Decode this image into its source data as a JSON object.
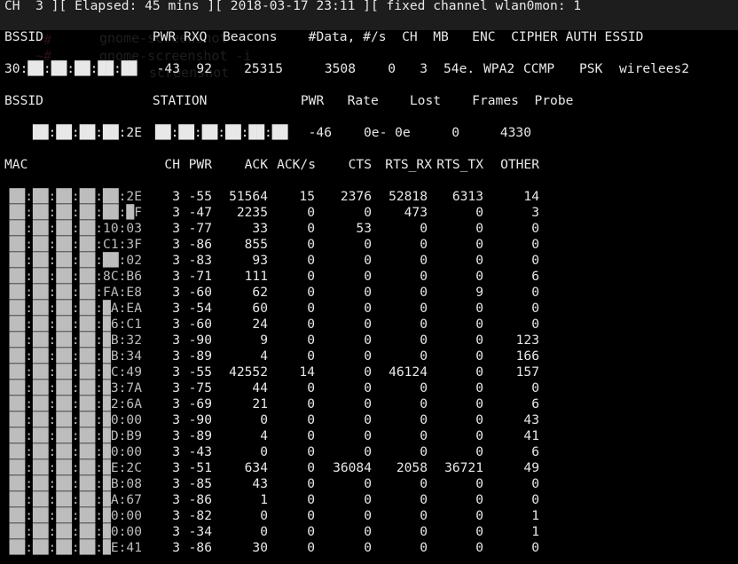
{
  "status_line": "CH  3 ][ Elapsed: 45 mins ][ 2018-03-17 23:11 ][ fixed channel wlan0mon: 1",
  "ghost_overlay": [
    "gnome-screenshot",
    "gnome-screenshot -i",
    "screenshot"
  ],
  "ap_table": {
    "header": "BSSID              PWR RXQ  Beacons    #Data, #/s  CH  MB   ENC  CIPHER AUTH ESSID",
    "rows": [
      {
        "bssid": "30:██:██:██:██:██",
        "pwr": "-43",
        "rxq": "92",
        "beacons": "25315",
        "data": "3508",
        "per_s": "0",
        "ch": "3",
        "mb": "54e.",
        "enc": "WPA2",
        "cipher": "CCMP",
        "auth": "PSK",
        "essid": "wirelees2"
      }
    ]
  },
  "station_table": {
    "header": "BSSID              STATION            PWR   Rate    Lost    Frames  Probe",
    "rows": [
      {
        "bssid": "██:██:██:██:2E",
        "station": "██:██:██:██:██:██",
        "pwr": "-46",
        "rate": "0e- 0e",
        "lost": "0",
        "frames": "4330",
        "probe": ""
      }
    ]
  },
  "mac_table": {
    "headers": [
      "MAC",
      "CH",
      "PWR",
      "ACK",
      "ACK/s",
      "CTS",
      "RTS_RX",
      "RTS_TX",
      "OTHER"
    ],
    "rows": [
      {
        "mac": "██:██:██:██:██:2E",
        "ch": "3",
        "pwr": "-55",
        "ack": "51564",
        "ack_s": "15",
        "cts": "2376",
        "rts_rx": "52818",
        "rts_tx": "6313",
        "other": "14"
      },
      {
        "mac": "██:██:██:██:██:█F",
        "ch": "3",
        "pwr": "-47",
        "ack": "2235",
        "ack_s": "0",
        "cts": "0",
        "rts_rx": "473",
        "rts_tx": "0",
        "other": "3"
      },
      {
        "mac": "██:██:██:██:10:03",
        "ch": "3",
        "pwr": "-77",
        "ack": "33",
        "ack_s": "0",
        "cts": "53",
        "rts_rx": "0",
        "rts_tx": "0",
        "other": "0"
      },
      {
        "mac": "██:██:██:██:C1:3F",
        "ch": "3",
        "pwr": "-86",
        "ack": "855",
        "ack_s": "0",
        "cts": "0",
        "rts_rx": "0",
        "rts_tx": "0",
        "other": "0"
      },
      {
        "mac": "██:██:██:██:██:02",
        "ch": "3",
        "pwr": "-83",
        "ack": "93",
        "ack_s": "0",
        "cts": "0",
        "rts_rx": "0",
        "rts_tx": "0",
        "other": "0"
      },
      {
        "mac": "██:██:██:██:8C:B6",
        "ch": "3",
        "pwr": "-71",
        "ack": "111",
        "ack_s": "0",
        "cts": "0",
        "rts_rx": "0",
        "rts_tx": "0",
        "other": "6"
      },
      {
        "mac": "██:██:██:██:FA:E8",
        "ch": "3",
        "pwr": "-60",
        "ack": "62",
        "ack_s": "0",
        "cts": "0",
        "rts_rx": "0",
        "rts_tx": "9",
        "other": "0"
      },
      {
        "mac": "██:██:██:██:█A:EA",
        "ch": "3",
        "pwr": "-54",
        "ack": "60",
        "ack_s": "0",
        "cts": "0",
        "rts_rx": "0",
        "rts_tx": "0",
        "other": "0"
      },
      {
        "mac": "██:██:██:██:█6:C1",
        "ch": "3",
        "pwr": "-60",
        "ack": "24",
        "ack_s": "0",
        "cts": "0",
        "rts_rx": "0",
        "rts_tx": "0",
        "other": "0"
      },
      {
        "mac": "██:██:██:██:█B:32",
        "ch": "3",
        "pwr": "-90",
        "ack": "9",
        "ack_s": "0",
        "cts": "0",
        "rts_rx": "0",
        "rts_tx": "0",
        "other": "123"
      },
      {
        "mac": "██:██:██:██:█B:34",
        "ch": "3",
        "pwr": "-89",
        "ack": "4",
        "ack_s": "0",
        "cts": "0",
        "rts_rx": "0",
        "rts_tx": "0",
        "other": "166"
      },
      {
        "mac": "██:██:██:██:█C:49",
        "ch": "3",
        "pwr": "-55",
        "ack": "42552",
        "ack_s": "14",
        "cts": "0",
        "rts_rx": "46124",
        "rts_tx": "0",
        "other": "157"
      },
      {
        "mac": "██:██:██:██:█3:7A",
        "ch": "3",
        "pwr": "-75",
        "ack": "44",
        "ack_s": "0",
        "cts": "0",
        "rts_rx": "0",
        "rts_tx": "0",
        "other": "0"
      },
      {
        "mac": "██:██:██:██:█2:6A",
        "ch": "3",
        "pwr": "-69",
        "ack": "21",
        "ack_s": "0",
        "cts": "0",
        "rts_rx": "0",
        "rts_tx": "0",
        "other": "6"
      },
      {
        "mac": "██:██:██:██:█0:00",
        "ch": "3",
        "pwr": "-90",
        "ack": "0",
        "ack_s": "0",
        "cts": "0",
        "rts_rx": "0",
        "rts_tx": "0",
        "other": "43"
      },
      {
        "mac": "██:██:██:██:█D:B9",
        "ch": "3",
        "pwr": "-89",
        "ack": "4",
        "ack_s": "0",
        "cts": "0",
        "rts_rx": "0",
        "rts_tx": "0",
        "other": "41"
      },
      {
        "mac": "██:██:██:██:█0:00",
        "ch": "3",
        "pwr": "-43",
        "ack": "0",
        "ack_s": "0",
        "cts": "0",
        "rts_rx": "0",
        "rts_tx": "0",
        "other": "6"
      },
      {
        "mac": "██:██:██:██:█E:2C",
        "ch": "3",
        "pwr": "-51",
        "ack": "634",
        "ack_s": "0",
        "cts": "36084",
        "rts_rx": "2058",
        "rts_tx": "36721",
        "other": "49"
      },
      {
        "mac": "██:██:██:██:█B:08",
        "ch": "3",
        "pwr": "-85",
        "ack": "43",
        "ack_s": "0",
        "cts": "0",
        "rts_rx": "0",
        "rts_tx": "0",
        "other": "0"
      },
      {
        "mac": "██:██:██:██:█A:67",
        "ch": "3",
        "pwr": "-86",
        "ack": "1",
        "ack_s": "0",
        "cts": "0",
        "rts_rx": "0",
        "rts_tx": "0",
        "other": "0"
      },
      {
        "mac": "██:██:██:██:█0:00",
        "ch": "3",
        "pwr": "-82",
        "ack": "0",
        "ack_s": "0",
        "cts": "0",
        "rts_rx": "0",
        "rts_tx": "0",
        "other": "1"
      },
      {
        "mac": "██:██:██:██:█0:00",
        "ch": "3",
        "pwr": "-34",
        "ack": "0",
        "ack_s": "0",
        "cts": "0",
        "rts_rx": "0",
        "rts_tx": "0",
        "other": "1"
      },
      {
        "mac": "██:██:██:██:█E:41",
        "ch": "3",
        "pwr": "-86",
        "ack": "30",
        "ack_s": "0",
        "cts": "0",
        "rts_rx": "0",
        "rts_tx": "0",
        "other": "0"
      }
    ]
  }
}
